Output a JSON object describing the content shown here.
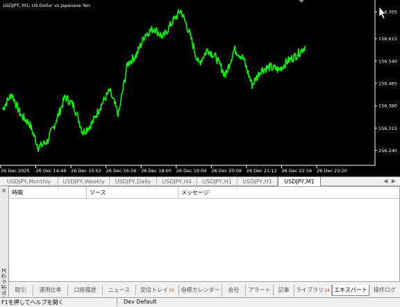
{
  "chart": {
    "title": "USDJPY, M1:  US Dollar vs Japanese Yen",
    "price_labels": [
      "156.705",
      "156.615",
      "156.540",
      "156.465",
      "156.390",
      "156.315",
      "156.240"
    ],
    "time_labels": [
      "26 Dec 2025",
      "26 Dec 14:48",
      "26 Dec 15:52",
      "26 Dec 16:56",
      "26 Dec 18:00",
      "26 Dec 19:04",
      "26 Dec 20:08",
      "26 Dec 21:12",
      "26 Dec 22:16",
      "26 Dec 23:20"
    ],
    "colors": {
      "background": "#000000",
      "price_line": "#00ff00",
      "axis": "#ffffff"
    }
  },
  "chart_data": {
    "type": "line",
    "title": "USDJPY, M1:  US Dollar vs Japanese Yen",
    "xlabel": "",
    "ylabel": "",
    "ylim": [
      156.19,
      156.745
    ],
    "x": [
      "26 Dec 2025",
      "26 Dec 14:48",
      "26 Dec 15:52",
      "26 Dec 16:56",
      "26 Dec 18:00",
      "26 Dec 19:04",
      "26 Dec 20:08",
      "26 Dec 21:12",
      "26 Dec 22:16",
      "26 Dec 23:20"
    ],
    "series": [
      {
        "values": [
          156.38,
          156.43,
          156.36,
          156.33,
          156.25,
          156.27,
          156.34,
          156.42,
          156.39,
          156.3,
          156.33,
          156.39,
          156.44,
          156.36,
          156.53,
          156.56,
          156.63,
          156.65,
          156.62,
          156.67,
          156.71,
          156.63,
          156.53,
          156.58,
          156.55,
          156.49,
          156.58,
          156.55,
          156.46,
          156.51,
          156.52,
          156.51,
          156.54,
          156.56,
          156.59
        ]
      }
    ]
  },
  "chart_tabs": [
    "USDJPY,Monthly",
    "USDJPY,Weekly",
    "USDJPY,Daily",
    "USDJPY,H4",
    "USDJPY,H1",
    "USDJPY,H1",
    "USDJPY,M1"
  ],
  "toolbox": {
    "title": "ツールボックス",
    "close": "×",
    "columns": [
      "時間",
      "ソース",
      "メッセージ"
    ]
  },
  "bottom_tabs": [
    {
      "label": "取引"
    },
    {
      "label": "運用比率"
    },
    {
      "label": "口座履歴"
    },
    {
      "label": "ニュース"
    },
    {
      "label": "受信トレイ",
      "badge": "10"
    },
    {
      "label": "指標カレンダー"
    },
    {
      "label": "会社"
    },
    {
      "label": "アラート"
    },
    {
      "label": "記事"
    },
    {
      "label": "ライブラリ",
      "badge": "24"
    },
    {
      "label": "エキスパート"
    },
    {
      "label": "操作ログ"
    }
  ],
  "status": {
    "help": "F1を押してヘルプを開く",
    "profile": "Dev Default"
  }
}
